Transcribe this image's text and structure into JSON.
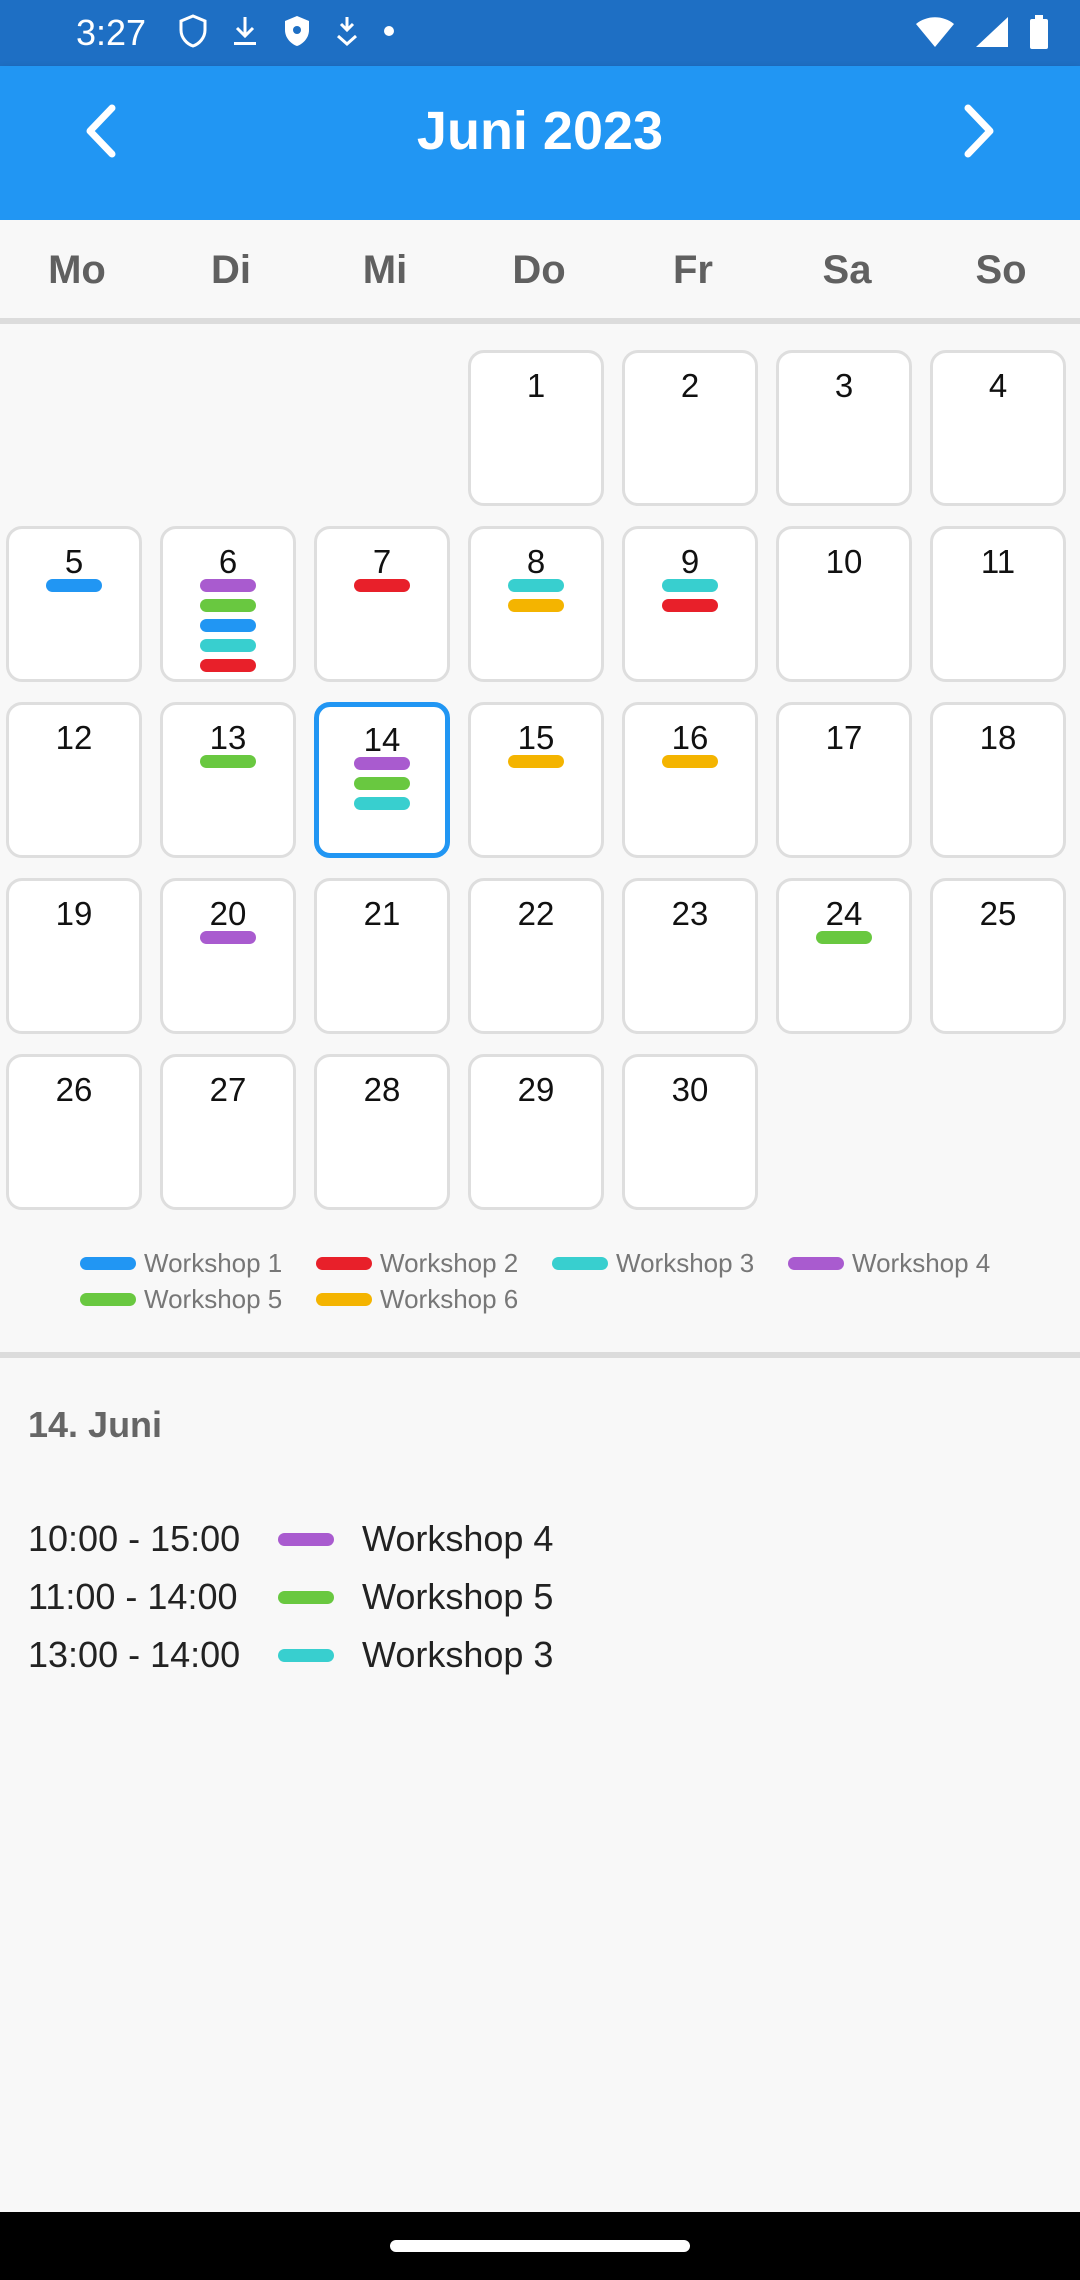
{
  "status": {
    "time": "3:27"
  },
  "header": {
    "title": "Juni 2023"
  },
  "weekdays": [
    "Mo",
    "Di",
    "Mi",
    "Do",
    "Fr",
    "Sa",
    "So"
  ],
  "colors": {
    "workshop_1": "#2196f3",
    "workshop_2": "#e8202a",
    "workshop_3": "#38cfcf",
    "workshop_4": "#a95bcf",
    "workshop_5": "#69c840",
    "workshop_6": "#f4b400"
  },
  "calendar": {
    "days": [
      {
        "day": "1",
        "row": 0,
        "col": 3,
        "events": []
      },
      {
        "day": "2",
        "row": 0,
        "col": 4,
        "events": []
      },
      {
        "day": "3",
        "row": 0,
        "col": 5,
        "events": []
      },
      {
        "day": "4",
        "row": 0,
        "col": 6,
        "events": []
      },
      {
        "day": "5",
        "row": 1,
        "col": 0,
        "events": [
          "workshop_1"
        ]
      },
      {
        "day": "6",
        "row": 1,
        "col": 1,
        "events": [
          "workshop_4",
          "workshop_5",
          "workshop_1",
          "workshop_3",
          "workshop_2"
        ]
      },
      {
        "day": "7",
        "row": 1,
        "col": 2,
        "events": [
          "workshop_2"
        ]
      },
      {
        "day": "8",
        "row": 1,
        "col": 3,
        "events": [
          "workshop_3",
          "workshop_6"
        ]
      },
      {
        "day": "9",
        "row": 1,
        "col": 4,
        "events": [
          "workshop_3",
          "workshop_2"
        ]
      },
      {
        "day": "10",
        "row": 1,
        "col": 5,
        "events": []
      },
      {
        "day": "11",
        "row": 1,
        "col": 6,
        "events": []
      },
      {
        "day": "12",
        "row": 2,
        "col": 0,
        "events": []
      },
      {
        "day": "13",
        "row": 2,
        "col": 1,
        "events": [
          "workshop_5"
        ]
      },
      {
        "day": "14",
        "row": 2,
        "col": 2,
        "events": [
          "workshop_4",
          "workshop_5",
          "workshop_3"
        ],
        "selected": true
      },
      {
        "day": "15",
        "row": 2,
        "col": 3,
        "events": [
          "workshop_6"
        ]
      },
      {
        "day": "16",
        "row": 2,
        "col": 4,
        "events": [
          "workshop_6"
        ]
      },
      {
        "day": "17",
        "row": 2,
        "col": 5,
        "events": []
      },
      {
        "day": "18",
        "row": 2,
        "col": 6,
        "events": []
      },
      {
        "day": "19",
        "row": 3,
        "col": 0,
        "events": []
      },
      {
        "day": "20",
        "row": 3,
        "col": 1,
        "events": [
          "workshop_4"
        ]
      },
      {
        "day": "21",
        "row": 3,
        "col": 2,
        "events": []
      },
      {
        "day": "22",
        "row": 3,
        "col": 3,
        "events": []
      },
      {
        "day": "23",
        "row": 3,
        "col": 4,
        "events": []
      },
      {
        "day": "24",
        "row": 3,
        "col": 5,
        "events": [
          "workshop_5"
        ]
      },
      {
        "day": "25",
        "row": 3,
        "col": 6,
        "events": []
      },
      {
        "day": "26",
        "row": 4,
        "col": 0,
        "events": []
      },
      {
        "day": "27",
        "row": 4,
        "col": 1,
        "events": []
      },
      {
        "day": "28",
        "row": 4,
        "col": 2,
        "events": []
      },
      {
        "day": "29",
        "row": 4,
        "col": 3,
        "events": []
      },
      {
        "day": "30",
        "row": 4,
        "col": 4,
        "events": []
      }
    ]
  },
  "legend": [
    {
      "key": "workshop_1",
      "label": "Workshop 1"
    },
    {
      "key": "workshop_2",
      "label": "Workshop 2"
    },
    {
      "key": "workshop_3",
      "label": "Workshop 3"
    },
    {
      "key": "workshop_4",
      "label": "Workshop 4"
    },
    {
      "key": "workshop_5",
      "label": "Workshop 5"
    },
    {
      "key": "workshop_6",
      "label": "Workshop 6"
    }
  ],
  "details": {
    "date": "14. Juni",
    "events": [
      {
        "time": "10:00 - 15:00",
        "key": "workshop_4",
        "label": "Workshop 4"
      },
      {
        "time": "11:00 - 14:00",
        "key": "workshop_5",
        "label": "Workshop 5"
      },
      {
        "time": "13:00 - 14:00",
        "key": "workshop_3",
        "label": "Workshop 3"
      }
    ]
  }
}
